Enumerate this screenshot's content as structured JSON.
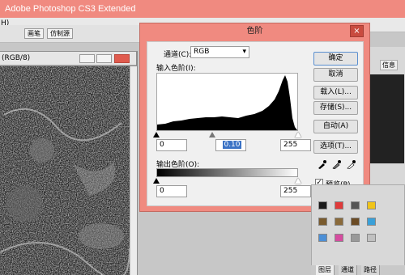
{
  "app": {
    "title": "Adobe Photoshop CS3 Extended"
  },
  "menubar": {
    "fragment": "H)"
  },
  "options_bar": {
    "chip1": "画笔",
    "chip2": "仿制源"
  },
  "document": {
    "title": "(RGB/8)"
  },
  "right_panel": {
    "tab": "信息"
  },
  "dialog": {
    "title": "色阶",
    "close_glyph": "×",
    "channel_label": "通道(C):",
    "channel_value": "RGB",
    "input_levels_label": "输入色阶(I):",
    "input_black": "0",
    "input_gamma": "0.10",
    "input_white": "255",
    "output_levels_label": "输出色阶(O):",
    "output_black": "0",
    "output_white": "255",
    "buttons": {
      "ok": "确定",
      "cancel": "取消",
      "load": "载入(L)...",
      "save": "存储(S)...",
      "auto": "自动(A)",
      "options": "选项(T)..."
    },
    "preview_label": "预览(P)",
    "preview_checked": true
  },
  "bottom_tabs": {
    "layers": "图层",
    "channels": "通道",
    "paths": "路径"
  },
  "colors": {
    "titlebar": "#f08a80",
    "dialog_frame": "#f08a80",
    "histogram": "#000000"
  }
}
